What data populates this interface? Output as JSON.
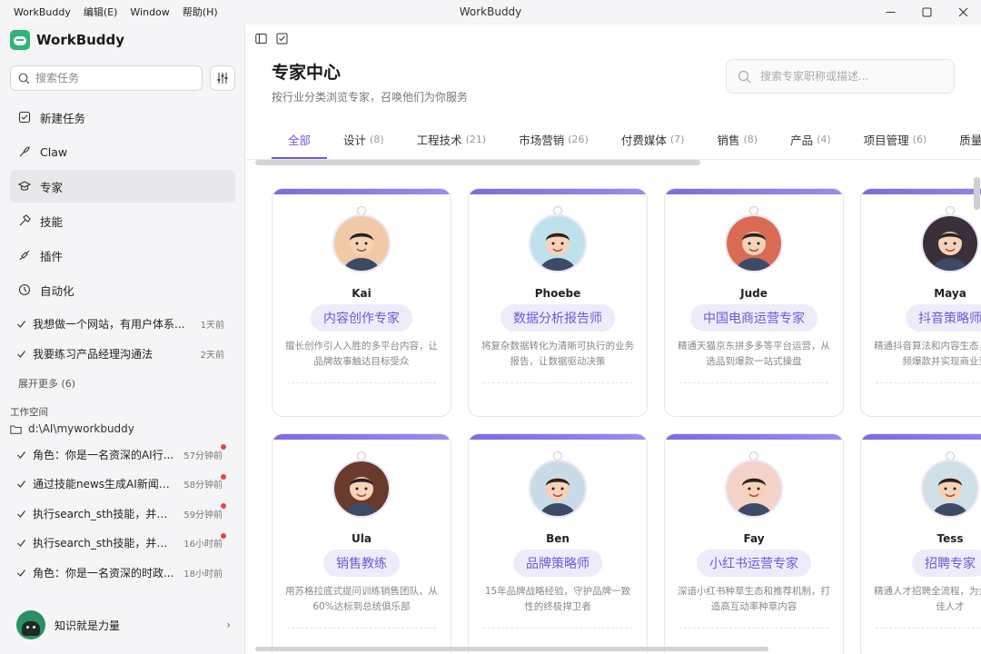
{
  "window": {
    "title": "WorkBuddy",
    "menus": [
      "WorkBuddy",
      "编辑(E)",
      "Window",
      "帮助(H)"
    ]
  },
  "sidebar": {
    "brand": "WorkBuddy",
    "search_placeholder": "搜索任务",
    "nav": [
      {
        "label": "新建任务",
        "icon": "new-task-icon"
      },
      {
        "label": "Claw",
        "icon": "claw-icon"
      },
      {
        "label": "专家",
        "icon": "expert-icon",
        "active": true
      },
      {
        "label": "技能",
        "icon": "skill-icon"
      },
      {
        "label": "插件",
        "icon": "plugin-icon"
      },
      {
        "label": "自动化",
        "icon": "automation-icon"
      }
    ],
    "recent": [
      {
        "text": "我想做一个网站，有用户体系...",
        "time": "1天前"
      },
      {
        "text": "我要练习产品经理沟通法",
        "time": "2天前"
      }
    ],
    "expand_more": "展开更多 (6)",
    "workspace_label": "工作空间",
    "workspace_path": "d:\\AI\\myworkbuddy",
    "workspace_items": [
      {
        "text": "角色：你是一名资深的AI行...",
        "time": "57分钟前",
        "unread": true
      },
      {
        "text": "通过技能news生成AI新闻追...",
        "time": "58分钟前",
        "unread": true
      },
      {
        "text": "执行search_sth技能，并把...",
        "time": "59分钟前",
        "unread": true
      },
      {
        "text": "执行search_sth技能，并把...",
        "time": "16小时前",
        "unread": true
      },
      {
        "text": "角色：你是一名资深的时政...",
        "time": "18小时前",
        "unread": false
      }
    ],
    "user_name": "知识就是力量"
  },
  "main": {
    "title": "专家中心",
    "subtitle": "按行业分类浏览专家，召唤他们为你服务",
    "search_placeholder": "搜索专家职称或描述...",
    "tabs": [
      {
        "label": "全部",
        "count": "",
        "active": true
      },
      {
        "label": "设计",
        "count": "(8)"
      },
      {
        "label": "工程技术",
        "count": "(21)"
      },
      {
        "label": "市场营销",
        "count": "(26)"
      },
      {
        "label": "付费媒体",
        "count": "(7)"
      },
      {
        "label": "销售",
        "count": "(8)"
      },
      {
        "label": "产品",
        "count": "(4)"
      },
      {
        "label": "项目管理",
        "count": "(6)"
      },
      {
        "label": "质量测试",
        "count": ""
      }
    ],
    "experts": [
      {
        "name": "Kai",
        "role": "内容创作专家",
        "desc": "擅长创作引人入胜的多平台内容，让品牌故事触达目标受众",
        "color": "#f2c9a6"
      },
      {
        "name": "Phoebe",
        "role": "数据分析报告师",
        "desc": "将复杂数据转化为清晰可执行的业务报告，让数据驱动决策",
        "color": "#bfe1ee"
      },
      {
        "name": "Jude",
        "role": "中国电商运营专家",
        "desc": "精通天猫京东拼多多等平台运营，从选品到爆款一站式操盘",
        "color": "#d96b55"
      },
      {
        "name": "Maya",
        "role": "抖音策略师",
        "desc": "精通抖音算法和内容生态，打造短视频爆款并实现商业变现",
        "color": "#3a2f3a"
      },
      {
        "name": "Ula",
        "role": "销售教练",
        "desc": "用苏格拉底式提问训练销售团队，从60%达标到总统俱乐部",
        "color": "#6a3b2c"
      },
      {
        "name": "Ben",
        "role": "品牌策略师",
        "desc": "15年品牌战略经验，守护品牌一致性的终极捍卫者",
        "color": "#c9dbe6"
      },
      {
        "name": "Fay",
        "role": "小红书运营专家",
        "desc": "深谙小红书种草生态和推荐机制，打造高互动率种草内容",
        "color": "#f4d3c8"
      },
      {
        "name": "Tess",
        "role": "招聘专家",
        "desc": "精通人才招聘全流程，为企业找到最佳人才",
        "color": "#cfe0e6"
      }
    ]
  }
}
